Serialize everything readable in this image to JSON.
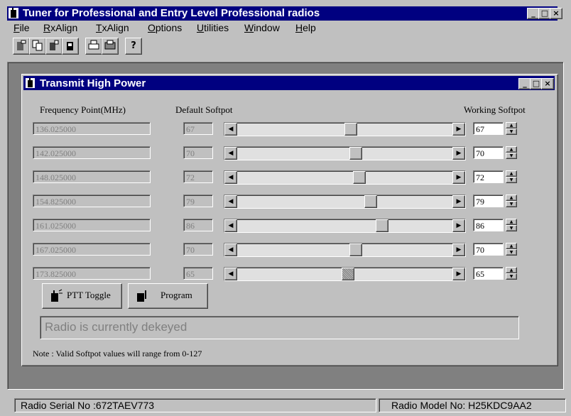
{
  "app": {
    "title": "Tuner for Professional and Entry Level Professional radios"
  },
  "menu": [
    "File",
    "RxAlign",
    "TxAlign",
    "Options",
    "Utilities",
    "Window",
    "Help"
  ],
  "toolbar": {
    "icons": [
      "open-radio-icon",
      "copy-icon",
      "radio-read-icon",
      "radio-write-icon",
      "print-icon",
      "print-preview-icon",
      "help-icon"
    ],
    "help_glyph": "?"
  },
  "child": {
    "title": "Transmit High Power",
    "headers": {
      "freq": "Frequency Point(MHz)",
      "default": "Default Softpot",
      "working": "Working Softpot"
    },
    "rows": [
      {
        "freq": "136.025000",
        "default": "67",
        "working": "67",
        "level": 67
      },
      {
        "freq": "142.025000",
        "default": "70",
        "working": "70",
        "level": 70
      },
      {
        "freq": "148.025000",
        "default": "72",
        "working": "72",
        "level": 72
      },
      {
        "freq": "154.825000",
        "default": "79",
        "working": "79",
        "level": 79
      },
      {
        "freq": "161.025000",
        "default": "86",
        "working": "86",
        "level": 86
      },
      {
        "freq": "167.025000",
        "default": "70",
        "working": "70",
        "level": 70
      },
      {
        "freq": "173.825000",
        "default": "65",
        "working": "65",
        "level": 65
      }
    ],
    "slider_max": 127,
    "buttons": {
      "ptt": "PTT Toggle",
      "program": "Program"
    },
    "status": "Radio is currently dekeyed",
    "note": "Note : Valid Softpot values will range from 0-127"
  },
  "statusbar": {
    "serial": "Radio Serial No :672TAEV773",
    "model": "Radio Model No: H25KDC9AA2"
  }
}
